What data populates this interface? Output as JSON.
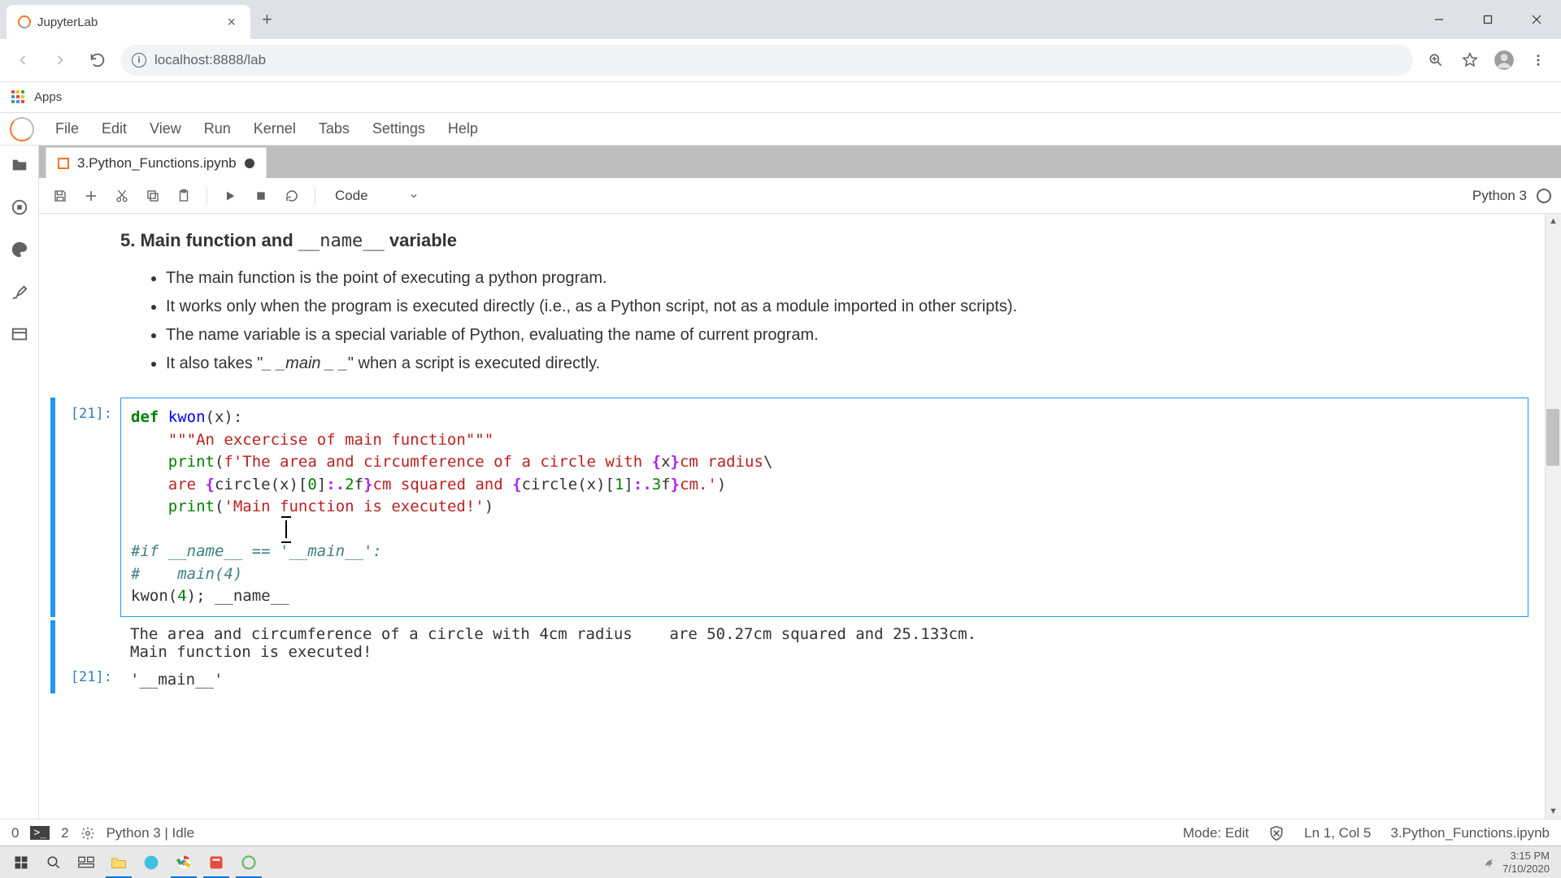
{
  "browser": {
    "tab_title": "JupyterLab",
    "url": "localhost:8888/lab",
    "apps_label": "Apps"
  },
  "menubar": [
    "File",
    "Edit",
    "View",
    "Run",
    "Kernel",
    "Tabs",
    "Settings",
    "Help"
  ],
  "notebook_tab": "3.Python_Functions.ipynb",
  "toolbar": {
    "cell_type": "Code",
    "kernel": "Python 3"
  },
  "markdown": {
    "heading_prefix": "5. Main function and ",
    "heading_mono": "__name__",
    "heading_suffix": " variable",
    "bullets": [
      "The main function is the point of executing a python program.",
      "It works only when the program is executed directly (i.e., as a Python script, not as a module imported in other scripts).",
      "The name variable is a special variable of Python, evaluating the name of current program.",
      "It also takes \"_ _main _ _\" when a script is executed directly."
    ]
  },
  "code": {
    "prompt": "[21]:",
    "lines": [
      {
        "t": "def",
        "p": [
          [
            "kw",
            "def "
          ],
          [
            "def",
            "kwon"
          ],
          [
            "",
            "(x):"
          ]
        ]
      },
      {
        "t": "doc",
        "p": [
          [
            "",
            "    "
          ],
          [
            "str",
            "\"\"\"An excercise of main function\"\"\""
          ]
        ]
      },
      {
        "t": "print1",
        "p": [
          [
            "",
            "    "
          ],
          [
            "builtin",
            "print"
          ],
          [
            "",
            "("
          ],
          [
            "str",
            "f'The area and circumference of a circle with "
          ],
          [
            "op",
            "{"
          ],
          [
            "",
            "x"
          ],
          [
            "op",
            "}"
          ],
          [
            "str",
            "cm radius"
          ],
          [
            "",
            "\\"
          ]
        ]
      },
      {
        "t": "print1b",
        "p": [
          [
            "",
            "    "
          ],
          [
            "str",
            "are "
          ],
          [
            "op",
            "{"
          ],
          [
            "",
            "circle(x)["
          ],
          [
            "num",
            "0"
          ],
          [
            "",
            "]"
          ],
          [
            "op",
            ":."
          ],
          [
            "num",
            "2"
          ],
          [
            "",
            "f"
          ],
          [
            "op",
            "}"
          ],
          [
            "str",
            "cm squared and "
          ],
          [
            "op",
            "{"
          ],
          [
            "",
            "circle(x)["
          ],
          [
            "num",
            "1"
          ],
          [
            "",
            "]"
          ],
          [
            "op",
            ":."
          ],
          [
            "num",
            "3"
          ],
          [
            "",
            "f"
          ],
          [
            "op",
            "}"
          ],
          [
            "str",
            "cm.'"
          ],
          [
            "",
            ")"
          ]
        ]
      },
      {
        "t": "print2",
        "p": [
          [
            "",
            "    "
          ],
          [
            "builtin",
            "print"
          ],
          [
            "",
            "("
          ],
          [
            "str",
            "'Main function is executed!'"
          ],
          [
            "",
            ")"
          ]
        ]
      },
      {
        "t": "blank",
        "p": [
          [
            "",
            ""
          ]
        ]
      },
      {
        "t": "c1",
        "p": [
          [
            "comment",
            "#if __name__ == '__main__':"
          ]
        ]
      },
      {
        "t": "c2",
        "p": [
          [
            "comment",
            "#    main(4)"
          ]
        ]
      },
      {
        "t": "call",
        "p": [
          [
            "",
            "kwon("
          ],
          [
            "num",
            "4"
          ],
          [
            "",
            "); __name__"
          ]
        ]
      }
    ]
  },
  "output": {
    "stdout": "The area and circumference of a circle with 4cm radius    are 50.27cm squared and 25.133cm.\nMain function is executed!",
    "result_prompt": "[21]:",
    "result_text": "'__main__'"
  },
  "status": {
    "tabs_count": "0",
    "terminals": "2",
    "kernel_status": "Python 3 | Idle",
    "mode": "Mode: Edit",
    "cursor": "Ln 1, Col 5",
    "path": "3.Python_Functions.ipynb"
  },
  "taskbar": {
    "time": "3:15 PM",
    "date": "7/10/2020"
  }
}
